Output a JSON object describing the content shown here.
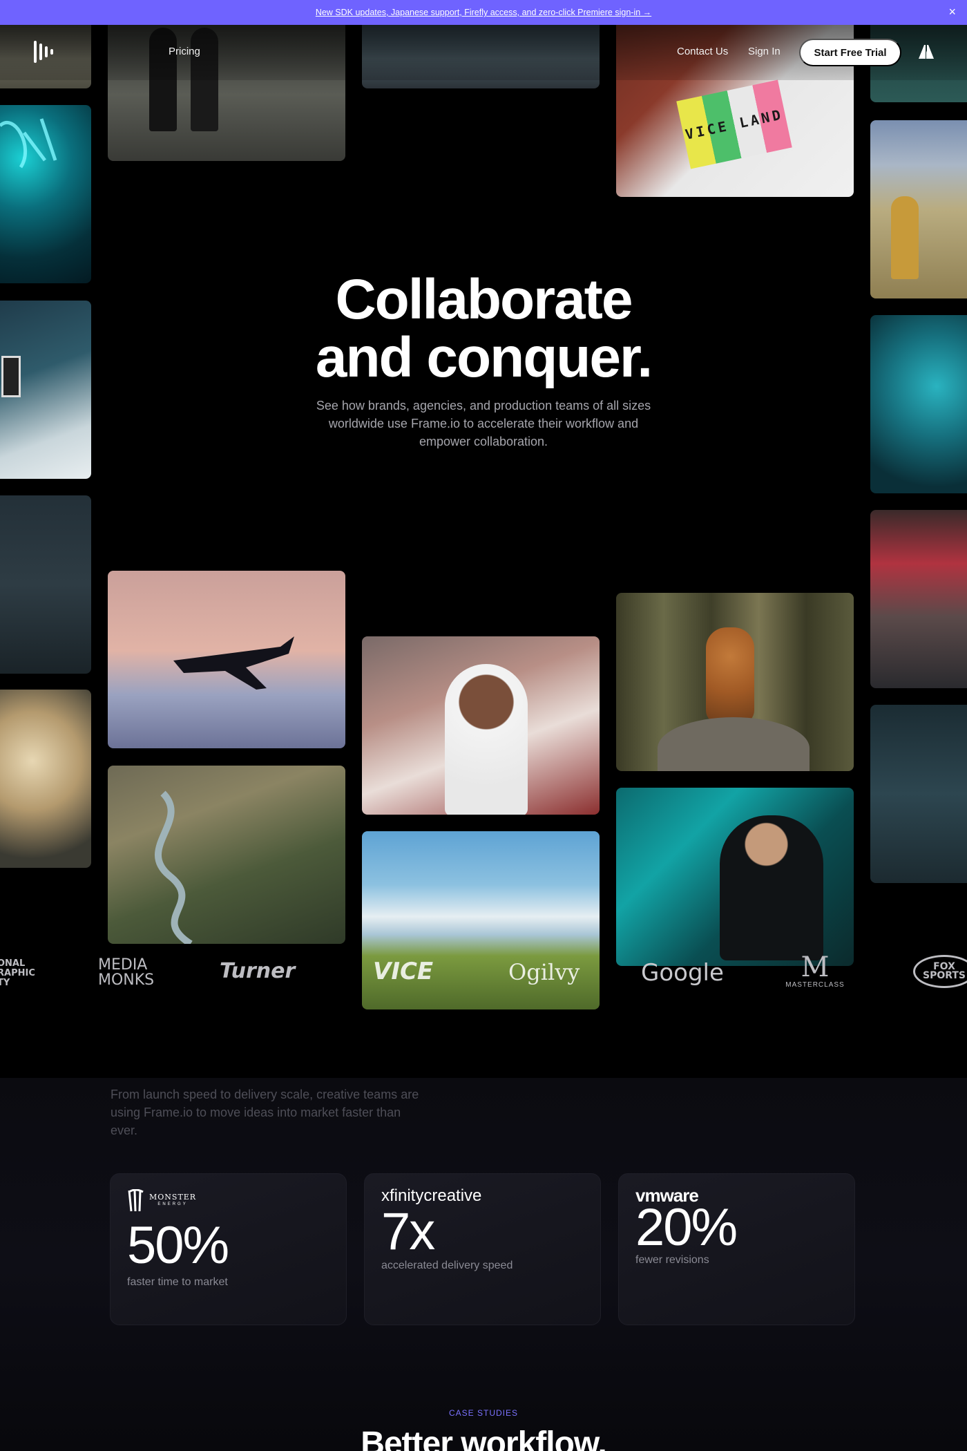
{
  "banner": {
    "text": "New SDK updates, Japanese support, Firefly access, and zero-click Premiere sign-in →",
    "close_symbol": "×"
  },
  "nav": {
    "pricing": "Pricing",
    "contact": "Contact Us",
    "signin": "Sign In",
    "trial": "Start Free Trial",
    "logo_icon": "frameio-logo-icon",
    "adobe_icon": "adobe-logo-icon"
  },
  "hero": {
    "title_line1": "Collaborate",
    "title_line2": "and conquer.",
    "subtitle": "See how brands, agencies, and production teams of all sizes worldwide use Frame.io to accelerate their workflow and empower collaboration.",
    "tile_sign": "VICE LAND"
  },
  "brands": {
    "natgeo": "ONAL\nRAPHIC\nTY",
    "mediamonks": "MEDIA\nMONKS",
    "turner": "Turner",
    "vice": "VICE",
    "ogilvy": "Ogilvy",
    "google": "Google",
    "masterclass": "MASTERCLASS",
    "fox": "FOX\nSPORTS"
  },
  "results": {
    "intro": "From launch speed to delivery scale, creative teams are using Frame.io to move ideas into market faster than ever.",
    "cards": [
      {
        "brand": "MONSTER",
        "brand_sub": "ENERGY",
        "value": "50%",
        "label": "faster time to market"
      },
      {
        "brand": "xfinity",
        "brand_sub": "creative",
        "value": "7x",
        "label": "accelerated delivery speed"
      },
      {
        "brand": "vmware",
        "brand_sub": "",
        "value": "20%",
        "label": "fewer revisions"
      }
    ]
  },
  "case_studies": {
    "label": "CASE STUDIES",
    "title": "Better workflow."
  },
  "colors": {
    "banner": "#6f63ff",
    "accent": "#7b72ff",
    "background": "#000000"
  }
}
